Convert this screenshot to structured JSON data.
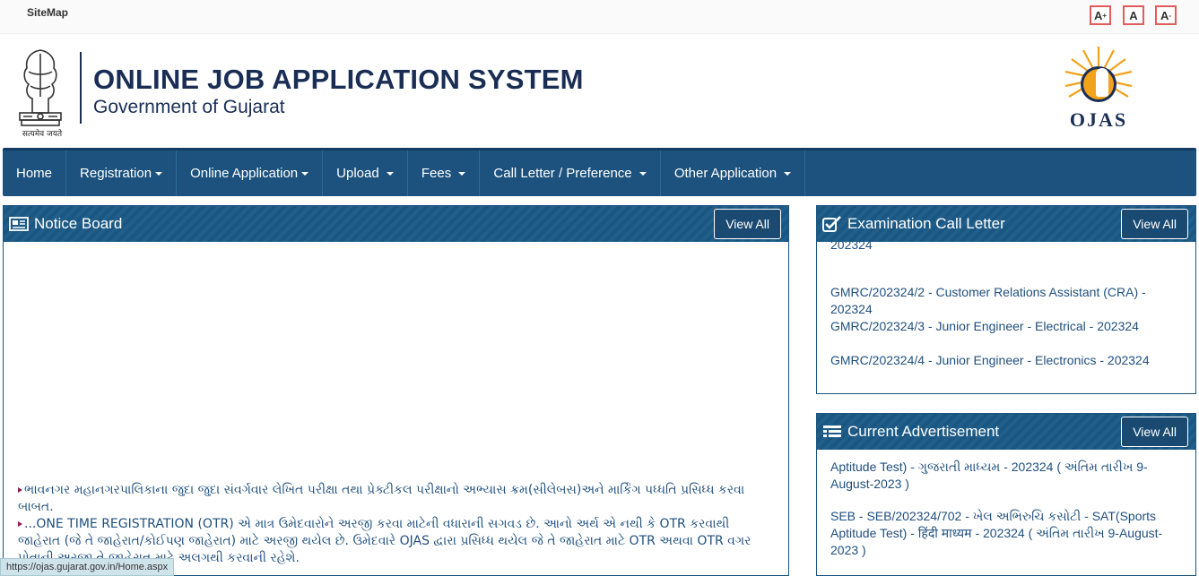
{
  "topbar": {
    "sitemap": "SiteMap",
    "font_increase": "A",
    "font_increase_sup": "+",
    "font_normal": "A",
    "font_decrease": "A",
    "font_decrease_sup": "-"
  },
  "header": {
    "motto": "सत्यमेव जयते",
    "title": "ONLINE JOB APPLICATION SYSTEM",
    "subtitle": "Government of Gujarat",
    "logo_text": "OJAS",
    "colors": {
      "brand": "#1a2e55",
      "nav": "#1c527d",
      "sun": "#f2a31c"
    }
  },
  "nav": {
    "items": [
      {
        "label": "Home",
        "dropdown": false
      },
      {
        "label": "Registration",
        "dropdown": true
      },
      {
        "label": "Online Application",
        "dropdown": true
      },
      {
        "label": "Upload",
        "dropdown": true
      },
      {
        "label": "Fees",
        "dropdown": true
      },
      {
        "label": "Call Letter / Preference",
        "dropdown": true
      },
      {
        "label": "Other Application",
        "dropdown": true
      }
    ]
  },
  "notice_board": {
    "title": "Notice Board",
    "icon": "newspaper-icon",
    "view_all": "View All",
    "items": [
      "ભાવનગર મહાનગરપાલિકાના જુદા જુદા સંવર્ગવાર લેખિત પરીક્ષા તથા પ્રેક્ટીકલ પરીક્ષાનો અભ્યાસ ક્રમ(સીલેબસ)અને માર્કિંગ પધ્ધતિ પ્રસિધ્ધ કરવા બાબત.",
      "...ONE TIME REGISTRATION (OTR) એ માત્ર ઉમેદવારોને અરજી કરવા માટેની વધારાની સગવડ છે. આનો અર્થ એ નથી કે OTR કરવાથી જાહેરાત (જે તે જાહેરાત/કોઈપણ જાહેરાત) માટે અરજી થયેલ છે. ઉમેદવારે OJAS દ્વારા પ્રસિધ્ધ થયેલ જે તે જાહેરાત માટે OTR અથવા OTR વગર પોતાની અરજી તે જાહેરાત માટે અલગથી કરવાની રહેશે."
    ]
  },
  "call_letter": {
    "title": "Examination Call Letter",
    "icon": "checkbox-icon",
    "view_all": "View All",
    "partial_top": "202324",
    "items": [
      "GMRC/202324/2 - Customer Relations Assistant (CRA) - 202324",
      "GMRC/202324/3 - Junior Engineer - Electrical - 202324",
      "GMRC/202324/4 - Junior Engineer - Electronics - 202324"
    ]
  },
  "advertisement": {
    "title": "Current Advertisement",
    "icon": "list-icon",
    "view_all": "View All",
    "partial_top": "Aptitude Test) - ગુજરાતી માધ્યમ - 202324 ( અંતિમ તારીખ 9-August-2023 )",
    "items": [
      "SEB - SEB/202324/702 - ખેલ અભિરુચિ કસોટી - SAT(Sports Aptitude Test) - हिंदी माध्यम - 202324 ( અંતિમ તારીખ 9-August-2023 )"
    ]
  },
  "statusbar": {
    "url": "https://ojas.gujarat.gov.in/Home.aspx"
  }
}
